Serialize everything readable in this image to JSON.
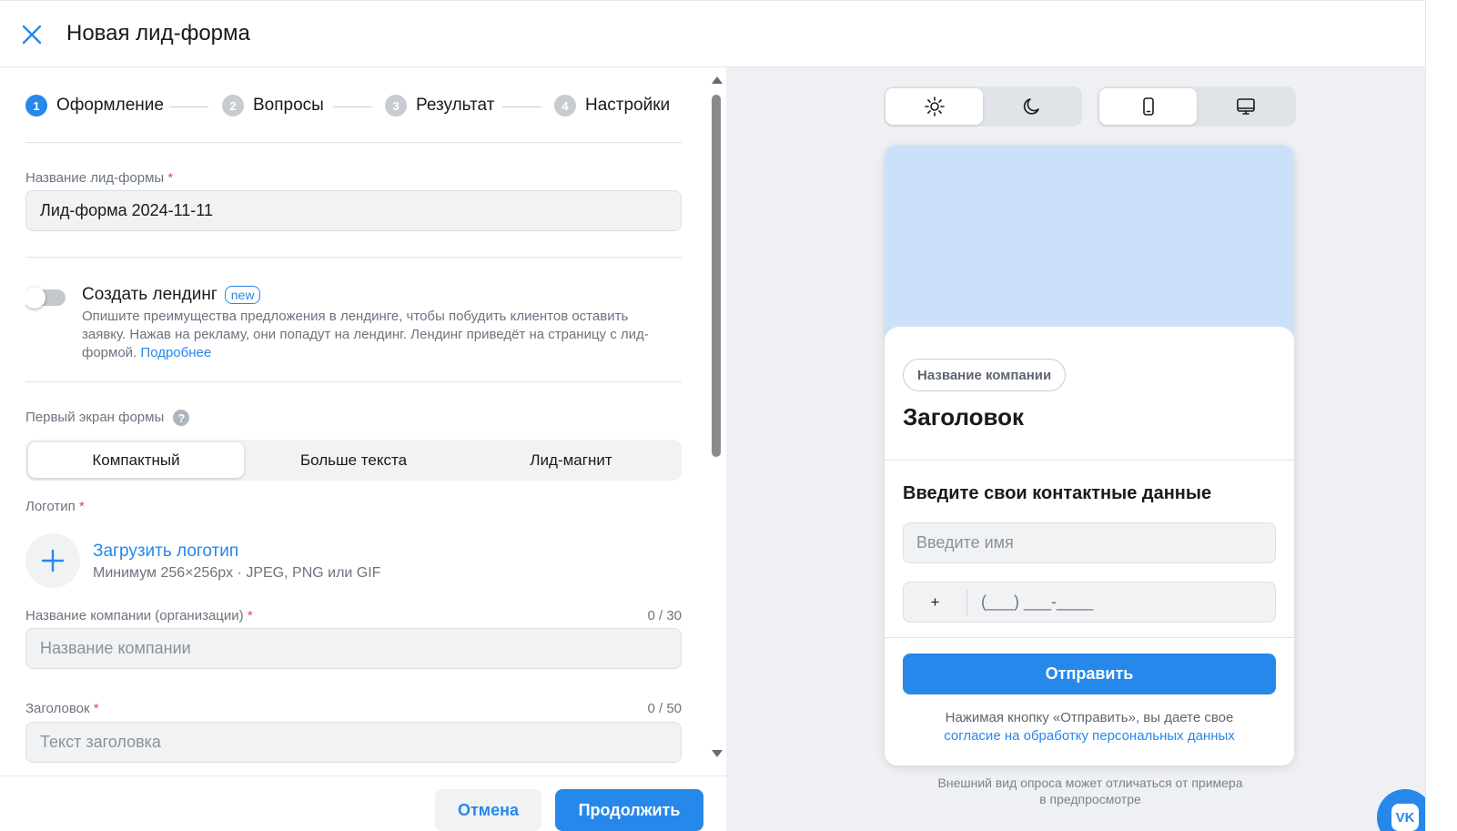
{
  "header": {
    "title": "Новая лид-форма",
    "close_icon": "close-icon"
  },
  "stepper": {
    "steps": [
      {
        "num": "1",
        "label": "Оформление",
        "active": true
      },
      {
        "num": "2",
        "label": "Вопросы",
        "active": false
      },
      {
        "num": "3",
        "label": "Результат",
        "active": false
      },
      {
        "num": "4",
        "label": "Настройки",
        "active": false
      }
    ]
  },
  "form": {
    "name_label": "Название лид-формы",
    "name_value": "Лид-форма 2024-11-11",
    "landing_title": "Создать лендинг",
    "landing_badge": "new",
    "landing_desc": "Опишите преимущества предложения в лендинге, чтобы побудить клиентов оставить заявку. Нажав на рекламу, они попадут на лендинг. Лендинг приведёт на страницу с лид-формой.",
    "landing_link": "Подробнее",
    "first_screen_label": "Первый экран формы",
    "first_screen_options": [
      "Компактный",
      "Больше текста",
      "Лид-магнит"
    ],
    "first_screen_selected": "Компактный",
    "logo_label": "Логотип",
    "logo_upload": "Загрузить логотип",
    "logo_hint": "Минимум 256×256px · JPEG, PNG или GIF",
    "company_label": "Название компании (организации)",
    "company_counter": "0 / 30",
    "company_placeholder": "Название компании",
    "heading_label": "Заголовок",
    "heading_counter": "0 / 50",
    "heading_placeholder": "Текст заголовка",
    "required_mark": "*"
  },
  "footer": {
    "cancel": "Отмена",
    "continue": "Продолжить"
  },
  "preview": {
    "theme_options": [
      "sun-icon",
      "moon-icon"
    ],
    "theme_selected": "sun-icon",
    "device_options": [
      "phone-icon",
      "desktop-icon"
    ],
    "device_selected": "phone-icon",
    "company_pill": "Название компании",
    "title": "Заголовок",
    "section_title": "Введите свои контактные данные",
    "name_placeholder": "Введите имя",
    "phone_code": "+",
    "phone_mask": "(___) ___-____",
    "submit": "Отправить",
    "consent_text": "Нажимая кнопку «Отправить», вы даете свое",
    "consent_link": "согласие на обработку персональных данных",
    "note": "Внешний вид опроса может отличаться от примера в предпросмотре",
    "vk_label": "VK"
  },
  "colors": {
    "accent": "#2688eb",
    "required": "#e64646",
    "cover": "#cce0fa"
  }
}
